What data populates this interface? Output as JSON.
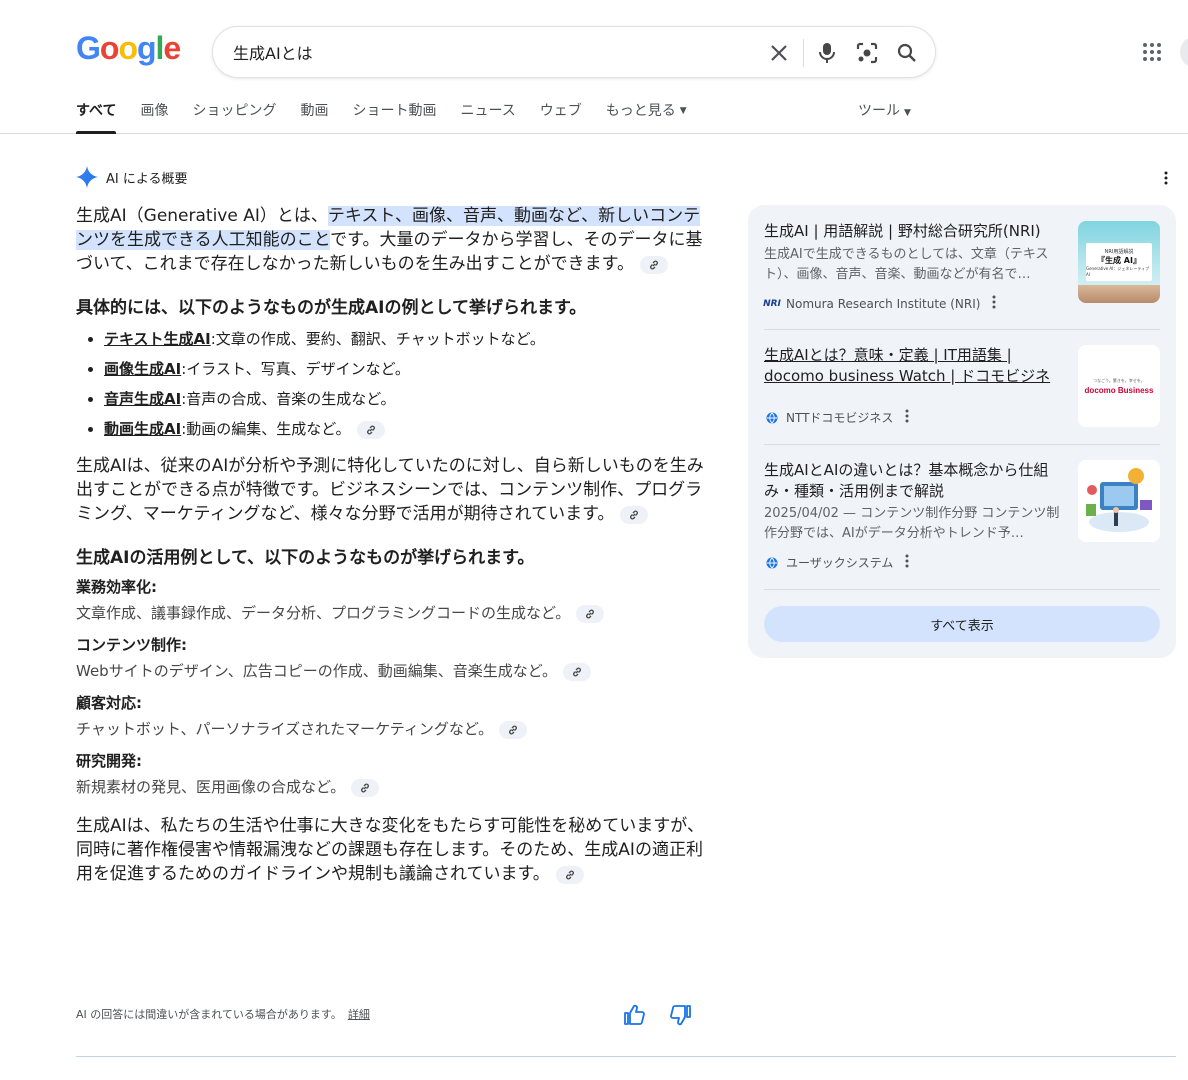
{
  "logo": "Google",
  "search": {
    "query": "生成AIとは"
  },
  "tabs": [
    {
      "label": "すべて",
      "active": true
    },
    {
      "label": "画像"
    },
    {
      "label": "ショッピング"
    },
    {
      "label": "動画"
    },
    {
      "label": "ショート動画"
    },
    {
      "label": "ニュース"
    },
    {
      "label": "ウェブ"
    },
    {
      "label": "もっと見る"
    }
  ],
  "tools_label": "ツール",
  "ai_overview": {
    "label": "AI による概要",
    "intro_pre": "生成AI（Generative AI）とは、",
    "intro_highlight": "テキスト、画像、音声、動画など、新しいコンテンツを生成できる人工知能のこと",
    "intro_post": "です。大量のデータから学習し、そのデータに基づいて、これまで存在しなかった新しいものを生み出すことができます。",
    "examples_heading": "具体的には、以下のようなものが生成AIの例として挙げられます。",
    "examples": [
      {
        "term": "テキスト生成AI",
        "desc": ":文章の作成、要約、翻訳、チャットボットなど。"
      },
      {
        "term": "画像生成AI",
        "desc": ":イラスト、写真、デザインなど。"
      },
      {
        "term": "音声生成AI",
        "desc": ":音声の合成、音楽の生成など。"
      },
      {
        "term": "動画生成AI",
        "desc": ":動画の編集、生成など。"
      }
    ],
    "feature_text": "生成AIは、従来のAIが分析や予測に特化していたのに対し、自ら新しいものを生み出すことができる点が特徴です。ビジネスシーンでは、コンテンツ制作、プログラミング、マーケティングなど、様々な分野で活用が期待されています。",
    "uses_heading": "生成AIの活用例として、以下のようなものが挙げられます。",
    "uses": [
      {
        "title": "業務効率化:",
        "text": "文章作成、議事録作成、データ分析、プログラミングコードの生成など。"
      },
      {
        "title": "コンテンツ制作:",
        "text": "Webサイトのデザイン、広告コピーの作成、動画編集、音楽生成など。"
      },
      {
        "title": "顧客対応:",
        "text": "チャットボット、パーソナライズされたマーケティングなど。"
      },
      {
        "title": "研究開発:",
        "text": "新規素材の発見、医用画像の合成など。"
      }
    ],
    "closing_text": "生成AIは、私たちの生活や仕事に大きな変化をもたらす可能性を秘めていますが、同時に著作権侵害や情報漏洩などの課題も存在します。そのため、生成AIの適正利用を促進するためのガイドラインや規制も議論されています。",
    "disclaimer": "AI の回答には間違いが含まれている場合があります。",
    "details_link": "詳細"
  },
  "sources": [
    {
      "title": "生成AI | 用語解説 | 野村総合研究所(NRI)",
      "snippet": "生成AIで生成できるものとしては、文章（テキスト）、画像、音声、音楽、動画などが有名で…",
      "site": "Nomura Research Institute (NRI)",
      "favicon": "NRI",
      "thumb_lines": [
        "NRI用語解説",
        "『生成 AI』",
        "Generative AI：ジェネレーティブ AI"
      ]
    },
    {
      "title": "生成AIとは？意味・定義 | IT用語集 | docomo business Watch | ドコモビジネス…",
      "snippet": "",
      "site": "NTTドコモビジネス",
      "favicon": "globe",
      "thumb_lines": [
        "つなごう。驚きを。幸せを。",
        "docomo Business"
      ]
    },
    {
      "title": "生成AIとAIの違いとは？基本概念から仕組み・種類・活用例まで解説",
      "snippet": "2025/04/02 — コンテンツ制作分野 コンテンツ制作分野では、AIがデータ分析やトレンド予…",
      "site": "ユーザックシステム",
      "favicon": "globe",
      "thumb_lines": []
    }
  ],
  "show_all_label": "すべて表示",
  "colors": {
    "google_blue": "#4285F4",
    "google_red": "#EA4335",
    "google_yellow": "#FBBC05",
    "google_green": "#34A853",
    "highlight": "#d3e3fd",
    "panel_bg": "#f0f4f9"
  }
}
